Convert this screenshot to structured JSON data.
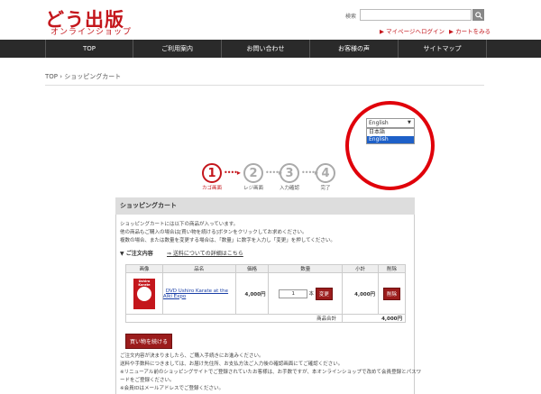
{
  "header": {
    "logo_title": "どう出版",
    "logo_sub": "オンラインショップ",
    "search_label": "検索",
    "search_placeholder": "",
    "mypage_link": "マイページへログイン",
    "cart_link": "カートをみる"
  },
  "nav": {
    "items": [
      "TOP",
      "ご利用案内",
      "お問い合わせ",
      "お客様の声",
      "サイトマップ"
    ]
  },
  "breadcrumb": {
    "home": "TOP",
    "separator": "›",
    "current": "ショッピングカート"
  },
  "language": {
    "selected": "English",
    "options": [
      "日本語",
      "English"
    ]
  },
  "steps": [
    {
      "num": "1",
      "label": "カゴ画面",
      "active": true
    },
    {
      "num": "2",
      "label": "レジ画面",
      "active": false
    },
    {
      "num": "3",
      "label": "入力確認",
      "active": false
    },
    {
      "num": "4",
      "label": "完了",
      "active": false
    }
  ],
  "cart": {
    "title": "ショッピングカート",
    "intro_lines": [
      "ショッピングカートには以下の商品が入っています。",
      "他の商品もご購入の場合は[買い物を続ける]ボタンをクリックしてお求めください。",
      "複数の場合、または数量を変更する場合は、「数量」に数字を入力し「変更」を押してください。"
    ],
    "notes_heading": "▼ ご注文内容",
    "notes_link": "⇒ 送料についての詳細はこちら",
    "columns": [
      "画像",
      "品名",
      "価格",
      "数量",
      "小計",
      "削除"
    ],
    "item": {
      "name": "DVD Ushiro Karate at the Aiki Expo",
      "price": "4,000円",
      "quantity": "1",
      "unit": "本",
      "change_label": "変更",
      "subtotal": "4,000円",
      "delete_label": "削除",
      "image_text": "Ushiro Karate"
    },
    "total_label": "商品合計",
    "total_value": "4,000円",
    "continue_label": "買い物を続ける",
    "footer_lines": [
      "ご注文内容が決まりましたら、ご購入手続きにお進みください。",
      "送料や手数料につきましては、お届け先住所、お支払方法ご入力後の確認画面にてご確認ください。",
      "※リニューアル前のショッピングサイトでご登録されていたお客様は、お手数ですが、本オンラインショップで改めて会員登録とパスワ",
      "ードをご登録ください。",
      "※会員IDはメールアドレスでご登録ください。"
    ]
  },
  "colors": {
    "brand_red": "#c4161c",
    "nav_bg": "#2a2a2a",
    "highlight_circle": "#e0000a",
    "selected_option": "#1e60c8"
  }
}
